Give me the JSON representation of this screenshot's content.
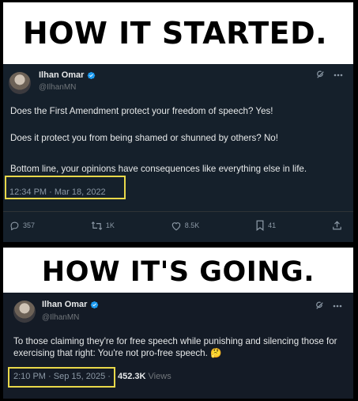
{
  "banners": {
    "top": "HOW IT STARTED.",
    "bottom": "HOW IT'S GOING."
  },
  "tweet_1": {
    "name": "Ilhan Omar",
    "handle": "@IlhanMN",
    "paragraphs": [
      "Does the First Amendment protect your freedom of speech? Yes!",
      "Does it protect you from being shamed or shunned by others? No!",
      "Bottom line, your opinions have consequences like everything else in life."
    ],
    "timestamp": "12:34 PM · Mar 18, 2022",
    "actions": {
      "replies": "357",
      "retweets": "1K",
      "likes": "8.5K",
      "bookmarks": "41"
    },
    "icons": [
      "verified-badge-icon",
      "grok-icon",
      "more-icon",
      "reply-icon",
      "retweet-icon",
      "like-icon",
      "bookmark-icon",
      "share-icon"
    ],
    "accent_color": "#1d9bf0"
  },
  "tweet_2": {
    "name": "Ilhan Omar",
    "handle": "@IlhanMN",
    "text": "To those claiming they're for free speech while punishing and silencing those for exercising that right: You're not pro-free speech.",
    "emoji": "🤔",
    "timestamp": "2:10 PM · Sep 15, 2025 ·",
    "views_count": "452.3K",
    "views_label": "Views"
  },
  "highlight_color": "#e8d84a"
}
